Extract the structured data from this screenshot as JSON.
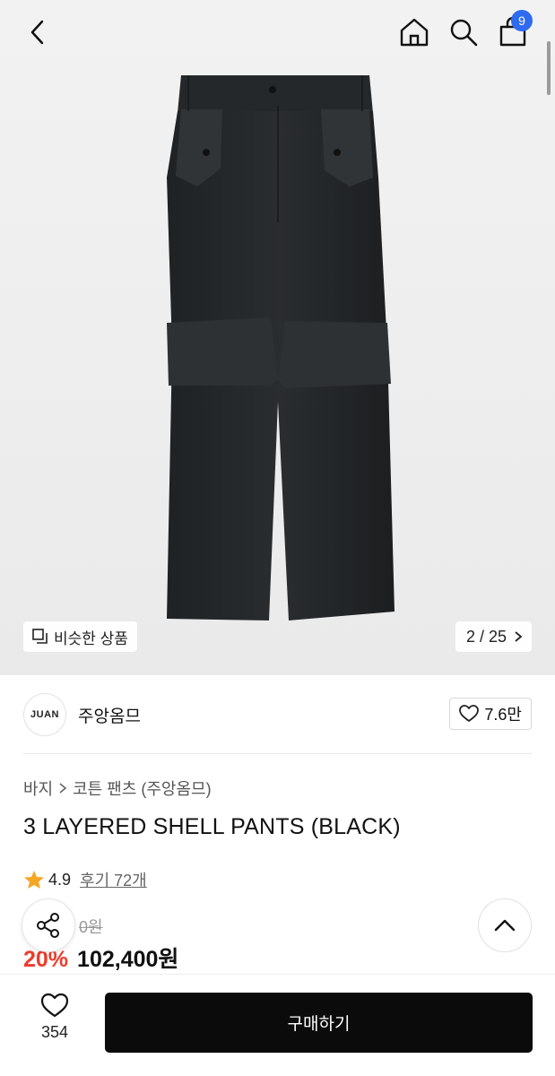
{
  "header": {
    "back_icon": "chevron-left-icon",
    "home_icon": "home-icon",
    "search_icon": "search-icon",
    "cart_icon": "shopping-bag-icon",
    "cart_count": "9"
  },
  "gallery": {
    "similar_label": "비슷한 상품",
    "pager": "2 / 25"
  },
  "brand": {
    "logo_text": "JUAN",
    "name": "주앙옴므",
    "likes": "7.6만"
  },
  "product": {
    "breadcrumb": [
      "바지",
      "코튼 팬츠 (주앙옴므)"
    ],
    "title": "3 LAYERED SHELL PANTS (BLACK)",
    "rating": "4.9",
    "reviews": "후기 72개",
    "original_price": "0원",
    "discount": "20%",
    "price": "102,400원"
  },
  "bottom": {
    "wish_count": "354",
    "buy_label": "구매하기"
  },
  "colors": {
    "accent_badge": "#2e6bf0",
    "discount": "#ef3b2c",
    "star": "#f5a623",
    "buy_button": "#0b0b0b"
  }
}
